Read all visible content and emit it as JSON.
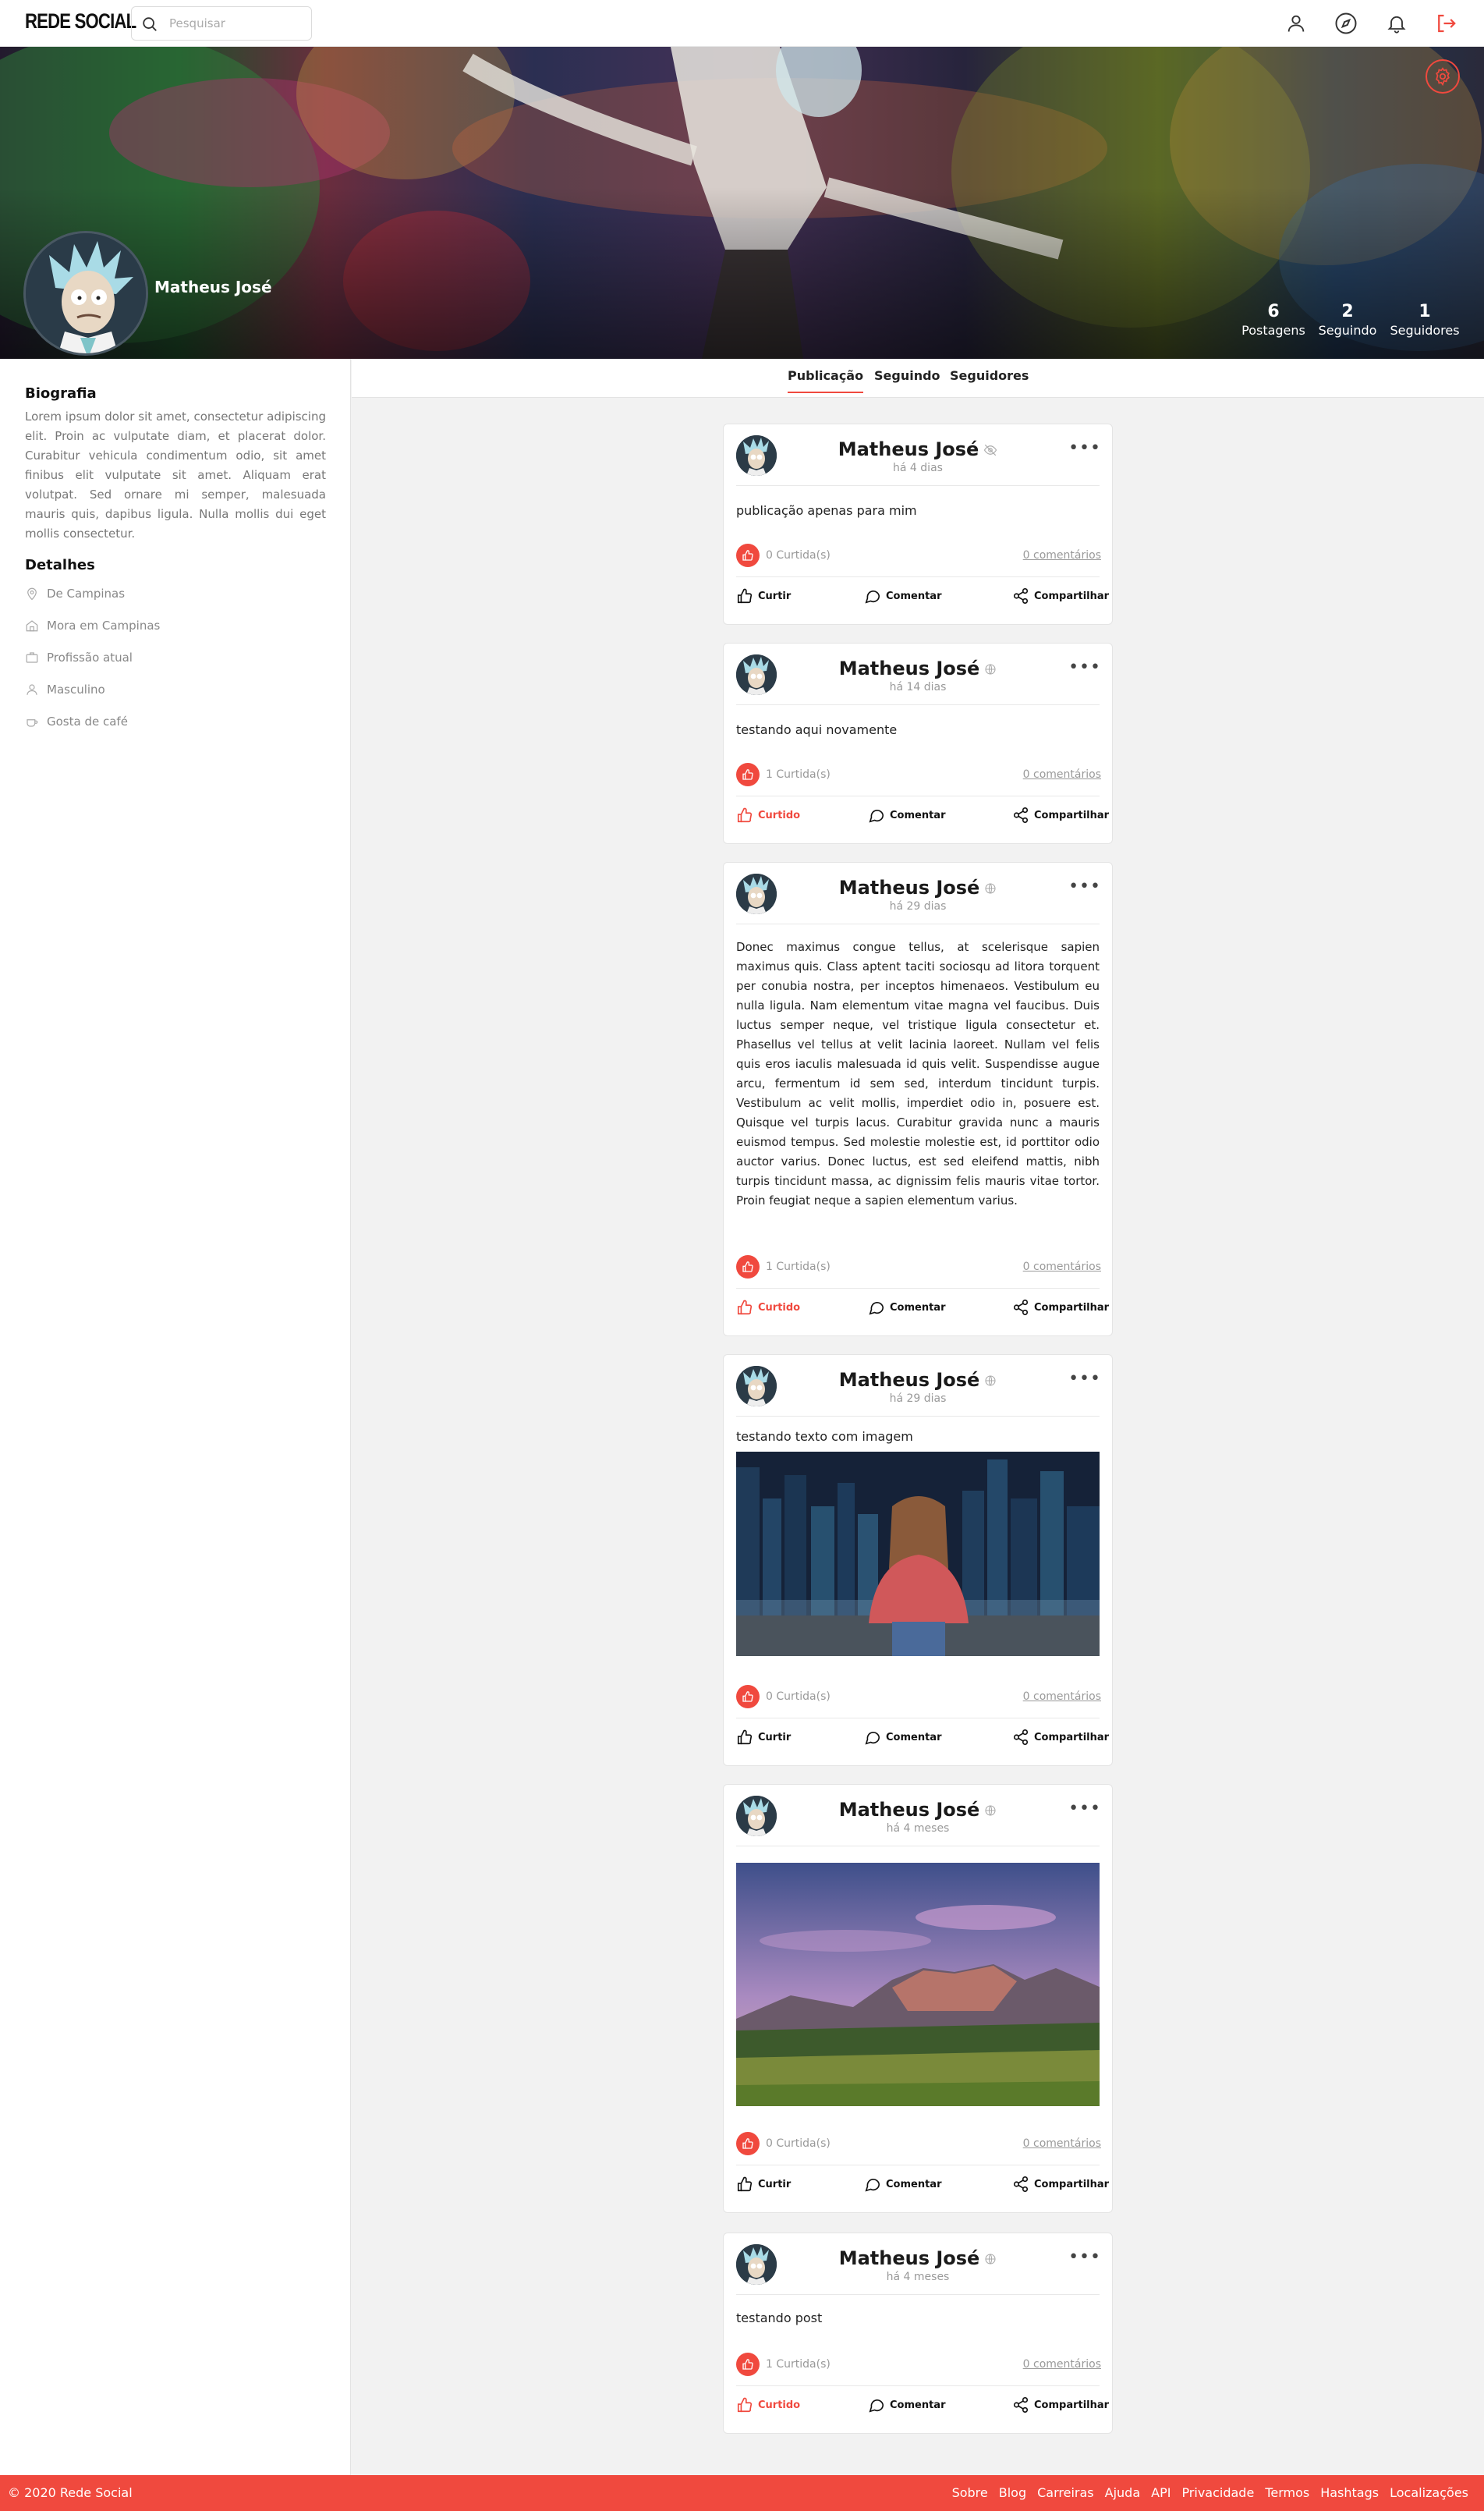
{
  "header": {
    "logo": "REDE SOCIAL",
    "search_placeholder": "Pesquisar",
    "nav_icons": [
      "user-icon",
      "compass-icon",
      "bell-icon",
      "logout-icon"
    ]
  },
  "profile": {
    "name": "Matheus José",
    "stats": [
      {
        "count": "6",
        "label": "Postagens"
      },
      {
        "count": "2",
        "label": "Seguindo"
      },
      {
        "count": "1",
        "label": "Seguidores"
      }
    ]
  },
  "sidebar": {
    "bio_title": "Biografia",
    "bio_text": "Lorem ipsum dolor sit amet, consectetur adipiscing elit. Proin ac vulputate diam, et placerat dolor. Curabitur vehicula condimentum odio, sit amet finibus elit vulputate sit amet. Aliquam erat volutpat. Sed ornare mi semper, malesuada mauris quis, dapibus ligula. Nulla mollis dui eget mollis consectetur.",
    "details_title": "Detalhes",
    "details": [
      {
        "icon": "location-pin-icon",
        "text": "De Campinas"
      },
      {
        "icon": "home-icon",
        "text": "Mora em Campinas"
      },
      {
        "icon": "briefcase-icon",
        "text": "Profissão atual"
      },
      {
        "icon": "person-icon",
        "text": "Masculino"
      },
      {
        "icon": "coffee-icon",
        "text": "Gosta de café"
      }
    ]
  },
  "tabs": [
    "Publicação",
    "Seguindo",
    "Seguidores"
  ],
  "actions": {
    "like": "Curtir",
    "liked": "Curtido",
    "comment": "Comentar",
    "share": "Compartilhar"
  },
  "posts": [
    {
      "author": "Matheus José",
      "visibility": "private",
      "time": "há 4 dias",
      "text": "publicação apenas para mim",
      "likes": "0 Curtida(s)",
      "comments": "0 comentários",
      "liked": false
    },
    {
      "author": "Matheus José",
      "visibility": "public",
      "time": "há 14 dias",
      "text": "testando aqui novamente",
      "likes": "1 Curtida(s)",
      "comments": "0 comentários",
      "liked": true
    },
    {
      "author": "Matheus José",
      "visibility": "public",
      "time": "há 29 dias",
      "text": "Donec maximus congue tellus, at scelerisque sapien maximus quis. Class aptent taciti sociosqu ad litora torquent per conubia nostra, per inceptos himenaeos. Vestibulum eu nulla ligula. Nam elementum vitae magna vel faucibus. Duis luctus semper neque, vel tristique ligula consectetur et. Phasellus vel tellus at velit lacinia laoreet. Nullam vel felis quis eros iaculis malesuada id quis velit. Suspendisse augue arcu, fermentum id sem sed, interdum tincidunt turpis. Vestibulum ac velit mollis, imperdiet odio in, posuere est. Quisque vel turpis lacus. Curabitur gravida nunc a mauris euismod tempus. Sed molestie molestie est, id porttitor odio auctor varius. Donec luctus, est sed eleifend mattis, nibh turpis tincidunt massa, ac dignissim felis mauris vitae tortor. Proin feugiat neque a sapien elementum varius.",
      "likes": "1 Curtida(s)",
      "comments": "0 comentários",
      "liked": true
    },
    {
      "author": "Matheus José",
      "visibility": "public",
      "time": "há 29 dias",
      "text": "testando texto com imagem",
      "likes": "0 Curtida(s)",
      "comments": "0 comentários",
      "liked": false
    },
    {
      "author": "Matheus José",
      "visibility": "public",
      "time": "há 4 meses",
      "text": "",
      "likes": "0 Curtida(s)",
      "comments": "0 comentários",
      "liked": false
    },
    {
      "author": "Matheus José",
      "visibility": "public",
      "time": "há 4 meses",
      "text": "testando post",
      "likes": "1 Curtida(s)",
      "comments": "0 comentários",
      "liked": true
    }
  ],
  "footer": {
    "copyright": "© 2020 Rede Social",
    "links": [
      "Sobre",
      "Blog",
      "Carreiras",
      "Ajuda",
      "API",
      "Privacidade",
      "Termos",
      "Hashtags",
      "Localizações"
    ]
  },
  "colors": {
    "accent": "#f0493e",
    "page_bg": "#f2f2f2",
    "card_bg": "#ffffff"
  }
}
